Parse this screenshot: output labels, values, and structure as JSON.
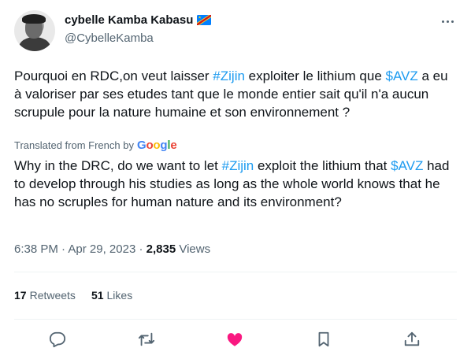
{
  "author": {
    "display_name": "cybelle Kamba Kabasu",
    "handle": "@CybelleKamba",
    "flag_icon": "drc-flag-icon"
  },
  "tweet": {
    "original_text": {
      "part1": "Pourquoi en RDC,on veut laisser ",
      "tag1": "#Zijin",
      "part2": " exploiter le lithium que ",
      "tag2": "$AVZ",
      "part3": " a eu à valoriser par ses etudes tant que le monde entier sait qu'il n'a aucun scrupule pour la nature humaine et son environnement ?"
    },
    "translation_label": "Translated from French by",
    "translation_provider": {
      "g1": "G",
      "o1": "o",
      "o2": "o",
      "g2": "g",
      "l": "l",
      "e": "e"
    },
    "translated_text": {
      "part1": "Why in the DRC, do we want to let ",
      "tag1": "#Zijin",
      "part2": " exploit the lithium that ",
      "tag2": "$AVZ",
      "part3": " had to develop through his studies as long as the whole world knows that he has no scruples for human nature and its environment?"
    },
    "time": "6:38 PM",
    "date": "Apr 29, 2023",
    "views_count": "2,835",
    "views_label": "Views"
  },
  "stats": {
    "retweets_count": "17",
    "retweets_label": "Retweets",
    "likes_count": "51",
    "likes_label": "Likes"
  },
  "actions": [
    "reply-icon",
    "retweet-icon",
    "like-icon",
    "bookmark-icon",
    "share-icon"
  ],
  "colors": {
    "link": "#1d9bf0",
    "secondary_text": "#536471",
    "like_active": "#f91880"
  }
}
